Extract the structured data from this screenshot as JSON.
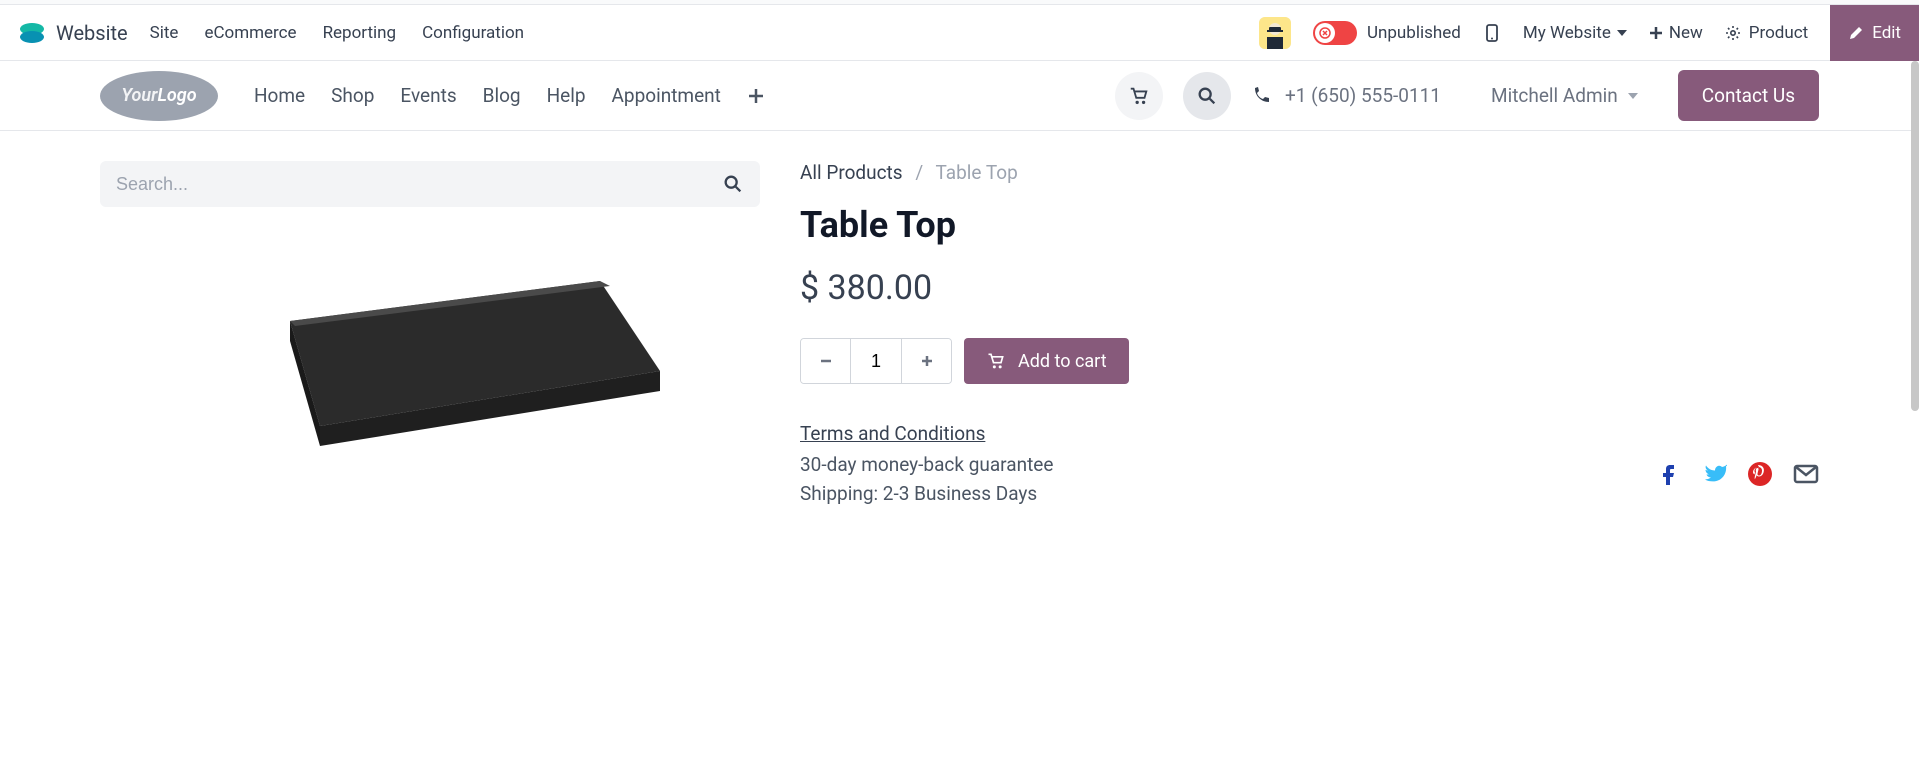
{
  "admin": {
    "brand": "Website",
    "menu": [
      "Site",
      "eCommerce",
      "Reporting",
      "Configuration"
    ],
    "publish_label": "Unpublished",
    "website_selector": "My Website",
    "new_label": "New",
    "product_label": "Product",
    "edit_label": "Edit"
  },
  "site": {
    "logo_your": "Your",
    "logo_logo": "Logo",
    "nav": [
      "Home",
      "Shop",
      "Events",
      "Blog",
      "Help",
      "Appointment"
    ],
    "phone": "+1 (650) 555-0111",
    "user": "Mitchell Admin",
    "contact_label": "Contact Us"
  },
  "search": {
    "placeholder": "Search..."
  },
  "breadcrumb": {
    "root": "All Products",
    "current": "Table Top"
  },
  "product": {
    "title": "Table Top",
    "currency": "$",
    "price": "380.00",
    "quantity": "1",
    "add_to_cart": "Add to cart",
    "terms": "Terms and Conditions",
    "guarantee": "30-day money-back guarantee",
    "shipping": "Shipping: 2-3 Business Days"
  }
}
